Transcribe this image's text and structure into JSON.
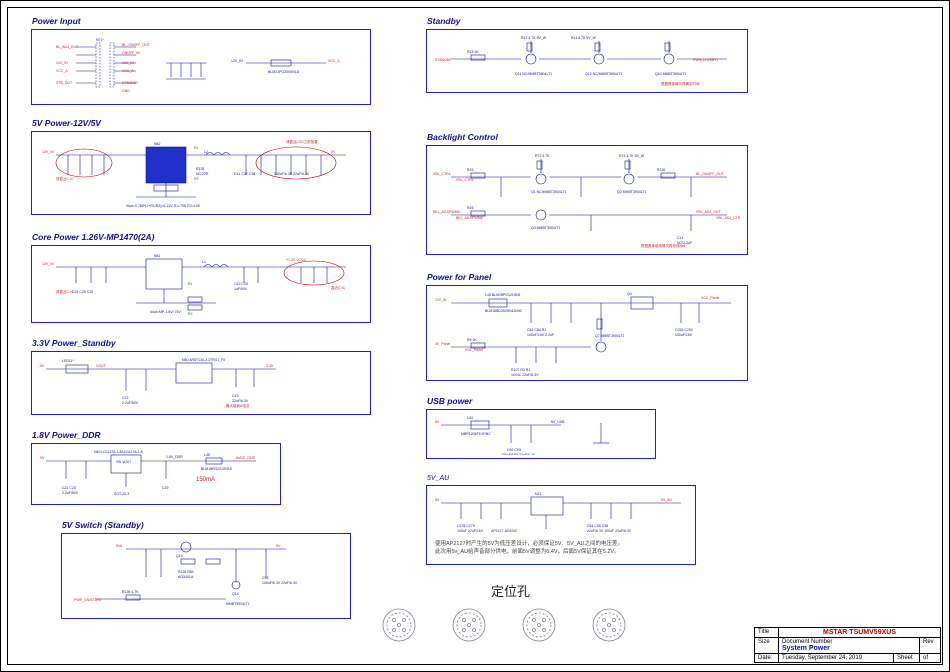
{
  "blocks": {
    "power_input": "Power Input",
    "pwr5v": "5V Power-12V/5V",
    "core": "Core Power 1.26V-MP1470(2A)",
    "stby33": "3.3V Power_Standby",
    "ddr18": "1.8V Power_DDR",
    "sw5v": "5V Switch (Standby)",
    "standby": "Standby",
    "blc": "Backlight Control",
    "panel": "Power for Panel",
    "usb": "USB power",
    "au5v": "5V_AU",
    "loc_holes": "定位孔"
  },
  "nets": {
    "bl_adj_out": "BL_ADJ_OUT",
    "bl_onoff_out": "BL_ONOFF_OUT",
    "onoff_in": "ONOFF_IN",
    "adj_in": "ADJ_IN",
    "v12_in": "12V_IN",
    "vcc_a": "VCC_A",
    "stb_out": "STB_OUT",
    "standby": "STANDBY",
    "vbl_ctrl": "VBL_CTRL",
    "bkl_adj_pwm": "BKL_ADJ/PWM#",
    "bl_onoff": "BL_ON/OFF",
    "v5": "5V",
    "v3p3": "3.3V",
    "vout": "VOUT",
    "v1p8_ddr": "1.8V_DDR",
    "vdd_core": "VDD_CORE",
    "avdd_ddr": "AVDD_DDR",
    "v5_au": "5V_AU",
    "v5_usb": "5V_USB",
    "vcc_panel": "VCC_Panel",
    "blm": "BLM21PG300SN1D",
    "a126": "+1.2V VCCC",
    "v12": "12V_IN",
    "vgl_panel": "VGL_Panel",
    "vin": "VIN",
    "pwr_on": "PWR(12V/SBY)",
    "pwr_on_stby": "PWR_ON/STBY#"
  },
  "notes": {
    "core_sub": "Core Power 1.26V-MP1470(2A)",
    "sot": "SOT-22-3",
    "au_note1": "使用AP2127时产生的5V为低压差设计，必须保证5V、5V_AU之间的电压差。",
    "au_note2": "此次用5v_AU给声音部分供电，前面5V调整为6.4V，后面5V保证其在5.2V。",
    "current": "150mA",
    "cn_note1": "根据具体使用情况再修改Bell",
    "cn_note2": "根据具体情况再确定时间"
  },
  "titleblock": {
    "title": "MSTAR  TSUMV59XUS",
    "docnum_label": "Document Number",
    "system": "System Power",
    "size": "Size",
    "date_label": "Date:",
    "date": "Tuesday, September 24, 2019",
    "sheet_label": "Sheet",
    "sheet": "of",
    "rev": "Rev"
  }
}
